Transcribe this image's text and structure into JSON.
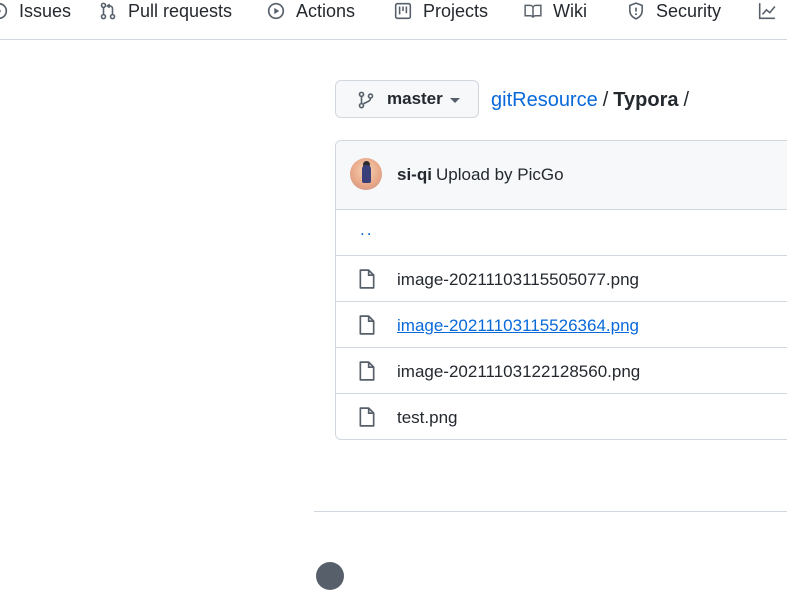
{
  "nav": {
    "tabs": [
      {
        "label": "Issues",
        "icon": "issue-icon"
      },
      {
        "label": "Pull requests",
        "icon": "pull-request-icon"
      },
      {
        "label": "Actions",
        "icon": "play-icon"
      },
      {
        "label": "Projects",
        "icon": "project-icon"
      },
      {
        "label": "Wiki",
        "icon": "book-icon"
      },
      {
        "label": "Security",
        "icon": "shield-icon"
      },
      {
        "label": "",
        "icon": "graph-icon"
      }
    ]
  },
  "branch": {
    "name": "master"
  },
  "breadcrumb": {
    "repo": "gitResource",
    "sep1": "/",
    "current": "Typora",
    "sep2": "/"
  },
  "commit": {
    "author": "si-qi",
    "message": "Upload by PicGo"
  },
  "files": {
    "updir": "..",
    "items": [
      {
        "name": "image-20211103115505077.png"
      },
      {
        "name": "image-20211103115526364.png",
        "hovered": true
      },
      {
        "name": "image-20211103122128560.png"
      },
      {
        "name": "test.png"
      }
    ]
  },
  "colors": {
    "link": "#0969da",
    "text": "#24292f",
    "border": "#d0d7de",
    "muted": "#57606a"
  }
}
